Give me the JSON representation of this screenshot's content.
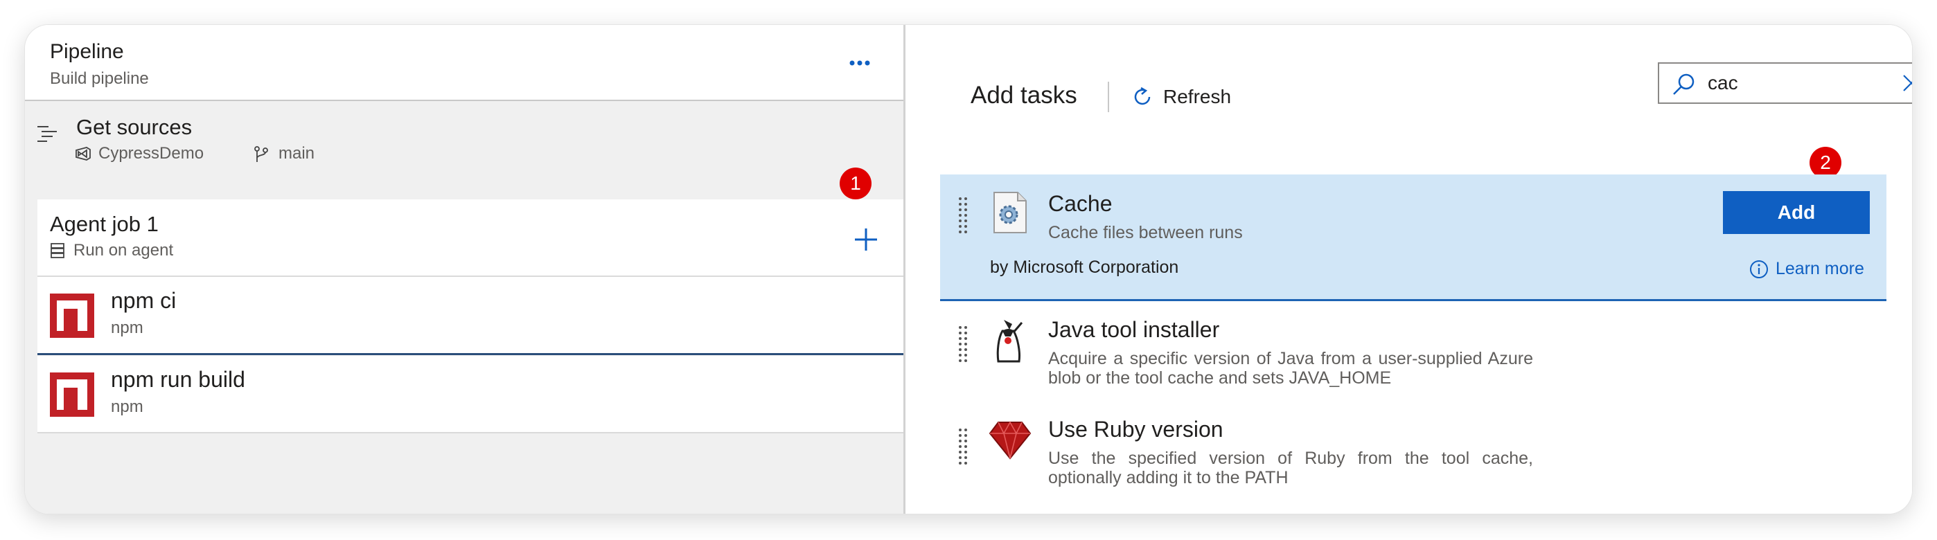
{
  "pipeline": {
    "title": "Pipeline",
    "subtitle": "Build pipeline",
    "more_icon": "more-dots-icon"
  },
  "get_sources": {
    "title": "Get sources",
    "repo": "CypressDemo",
    "branch": "main"
  },
  "agent_job": {
    "title": "Agent job 1",
    "subtitle": "Run on agent",
    "badge": "1"
  },
  "tasks": [
    {
      "title": "npm ci",
      "subtitle": "npm"
    },
    {
      "title": "npm run build",
      "subtitle": "npm"
    }
  ],
  "add_tasks_panel": {
    "title": "Add tasks",
    "refresh_label": "Refresh",
    "search_value": "cac",
    "badge": "2",
    "add_label": "Add",
    "learn_more_label": "Learn more",
    "results": [
      {
        "title": "Cache",
        "description": "Cache files between runs",
        "publisher": "by Microsoft Corporation"
      },
      {
        "title": "Java tool installer",
        "description": "Acquire a specific version of Java from a user-supplied Azure blob or the tool cache and sets JAVA_HOME"
      },
      {
        "title": "Use Ruby version",
        "description": "Use the specified version of Ruby from the tool cache, optionally adding it to the PATH"
      }
    ]
  },
  "colors": {
    "accent": "#0f5fc2",
    "selected_row": "#d1e6f7",
    "badge": "#e00000",
    "npm": "#c12127"
  }
}
